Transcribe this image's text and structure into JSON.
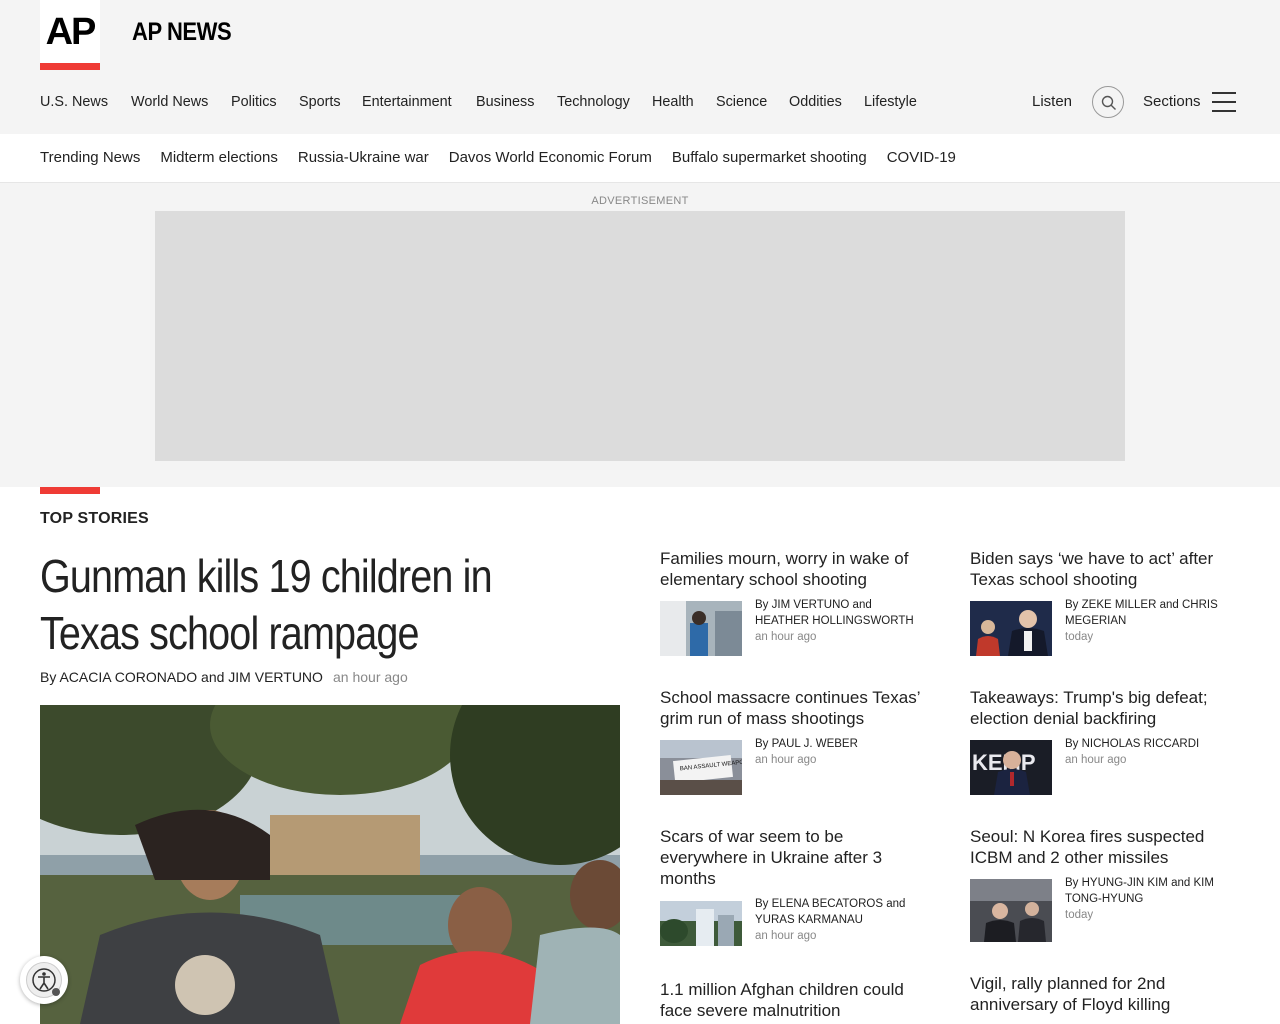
{
  "brand": {
    "logo": "AP",
    "site_name": "AP NEWS"
  },
  "main_nav": [
    "U.S. News",
    "World News",
    "Politics",
    "Sports",
    "Entertainment",
    "Business",
    "Technology",
    "Health",
    "Science",
    "Oddities",
    "Lifestyle"
  ],
  "header_actions": {
    "listen": "Listen",
    "sections": "Sections",
    "search_icon": "search-icon",
    "menu_icon": "hamburger-menu-icon"
  },
  "trending": [
    "Trending News",
    "Midterm elections",
    "Russia-Ukraine war",
    "Davos World Economic Forum",
    "Buffalo supermarket shooting",
    "COVID-19"
  ],
  "ad": {
    "label": "ADVERTISEMENT"
  },
  "top_stories": {
    "label": "TOP STORIES",
    "lead": {
      "headline": "Gunman kills 19 children in Texas school rampage",
      "by": "By",
      "authors": "ACACIA CORONADO and JIM VERTUNO",
      "time": "an hour ago"
    },
    "stories": [
      {
        "title": "Families mourn, worry in wake of elementary school shooting",
        "by": "By",
        "authors": "JIM VERTUNO and HEATHER HOLLINGSWORTH",
        "time": "an hour ago"
      },
      {
        "title": "Biden says ‘we have to act’ after Texas school shooting",
        "by": "By",
        "authors": "ZEKE MILLER and CHRIS MEGERIAN",
        "time": "today"
      },
      {
        "title": "School massacre continues Texas’ grim run of mass shootings",
        "by": "By",
        "authors": "PAUL J. WEBER",
        "time": "an hour ago"
      },
      {
        "title": "Takeaways: Trump's big defeat; election denial backfiring",
        "by": "By",
        "authors": "NICHOLAS RICCARDI",
        "time": "an hour ago"
      },
      {
        "title": "Scars of war seem to be everywhere in Ukraine after 3 months",
        "by": "By",
        "authors": "ELENA BECATOROS and YURAS KARMANAU",
        "time": "an hour ago"
      },
      {
        "title": "Seoul: N Korea fires suspected ICBM and 2 other missiles",
        "by": "By",
        "authors": "HYUNG-JIN KIM and KIM TONG-HYUNG",
        "time": "today"
      },
      {
        "title": "1.1 million Afghan children could face severe malnutrition"
      },
      {
        "title": "Vigil, rally planned for 2nd anniversary of Floyd killing"
      }
    ]
  },
  "thumb_text": {
    "sign": "BAN ASSAULT WEAPONS NOW!",
    "kemp": "KEMP"
  },
  "colors": {
    "accent": "#ef3b35",
    "header_bg": "#f4f4f4",
    "ad_bg": "#dcdcdc"
  }
}
